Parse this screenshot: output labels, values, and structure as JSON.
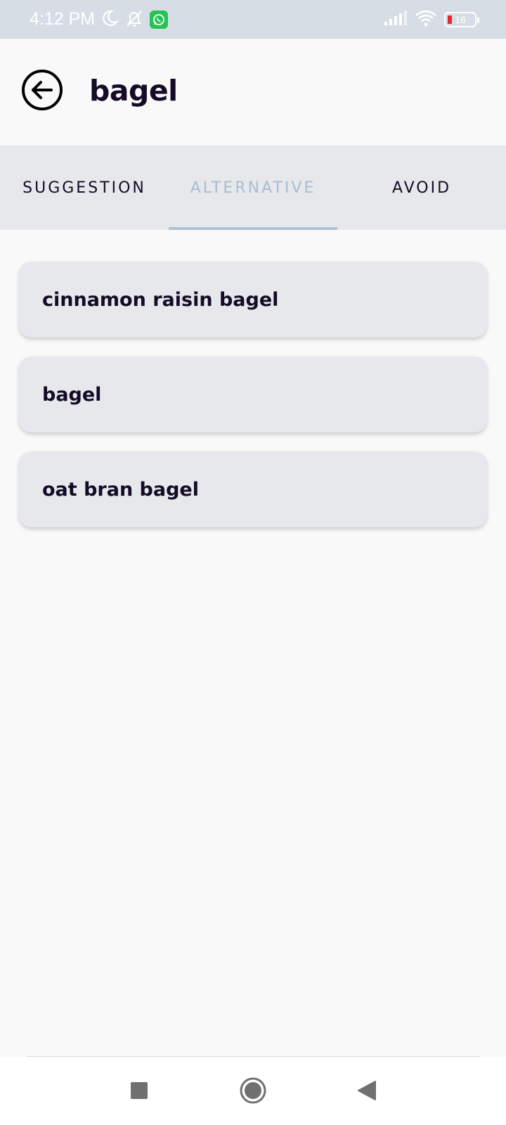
{
  "status_bar": {
    "time": "4:12 PM",
    "battery_level": "16",
    "icons": [
      "moon-icon",
      "bell-off-icon",
      "whatsapp-icon",
      "signal-icon",
      "wifi-icon",
      "battery-icon"
    ]
  },
  "header": {
    "title": "bagel",
    "back_icon": "arrow-left-circle-icon"
  },
  "tabs": [
    {
      "label": "SUGGESTION",
      "active": false
    },
    {
      "label": "ALTERNATIVE",
      "active": true
    },
    {
      "label": "AVOID",
      "active": false
    }
  ],
  "items": [
    {
      "label": "cinnamon raisin bagel"
    },
    {
      "label": "bagel"
    },
    {
      "label": "oat bran bagel"
    }
  ],
  "nav_bar": {
    "icons": [
      "recents-square-icon",
      "home-circle-icon",
      "back-triangle-icon"
    ]
  },
  "colors": {
    "accent_active_tab": "#a9bdd0",
    "text_dark": "#140b26",
    "card_bg": "#e6e8ec",
    "status_bar_bg": "#d7dde5"
  }
}
